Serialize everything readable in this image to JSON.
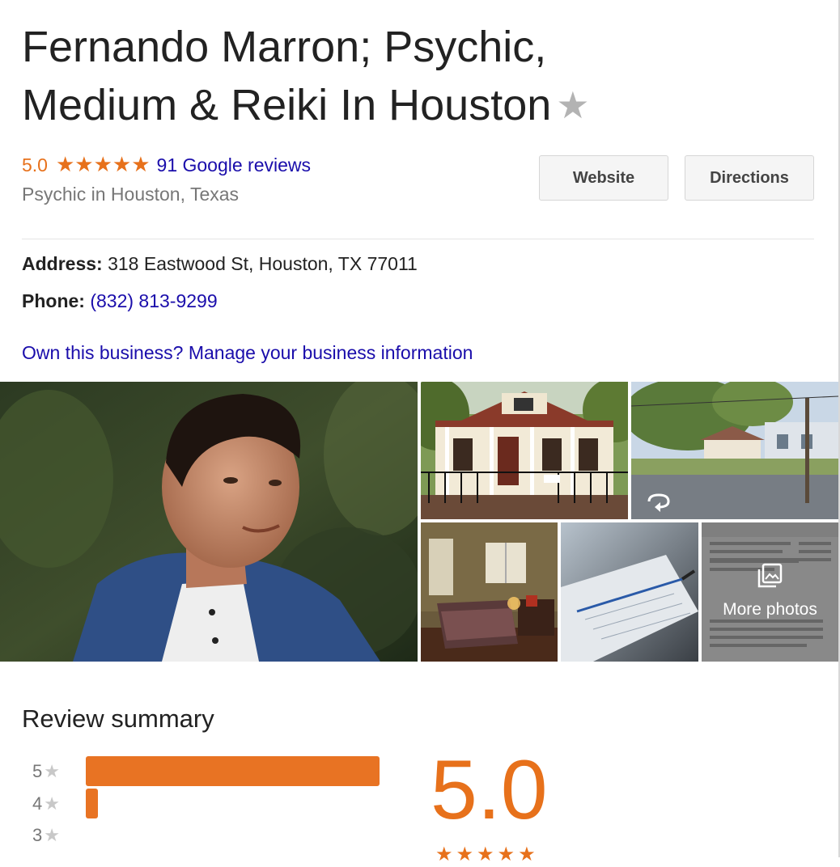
{
  "business": {
    "name": "Fernando Marron; Psychic, Medium & Reiki In Houston",
    "save_star": "★",
    "rating": "5.0",
    "stars": "★★★★★",
    "reviews_link": "91 Google reviews",
    "category": "Psychic in Houston, Texas"
  },
  "actions": {
    "website_label": "Website",
    "directions_label": "Directions"
  },
  "info": {
    "address_label": "Address:",
    "address_value": "318 Eastwood St, Houston, TX 77011",
    "phone_label": "Phone:",
    "phone_value": "(832) 813-9299"
  },
  "own_business_link": "Own this business? Manage your business information",
  "photos": {
    "more_label": "More photos"
  },
  "review_summary": {
    "title": "Review summary",
    "overall": "5.0",
    "overall_stars": "★★★★★",
    "bars": [
      {
        "label": "5",
        "star": "★",
        "fraction": 0.98
      },
      {
        "label": "4",
        "star": "★",
        "fraction": 0.04
      },
      {
        "label": "3",
        "star": "★",
        "fraction": 0.0
      }
    ]
  },
  "colors": {
    "accent_orange": "#e7711b",
    "link_blue": "#1a0dab",
    "bar_orange": "#e87323"
  },
  "icons": [
    "star-icon",
    "rotate-360-icon",
    "photo-gallery-icon"
  ]
}
